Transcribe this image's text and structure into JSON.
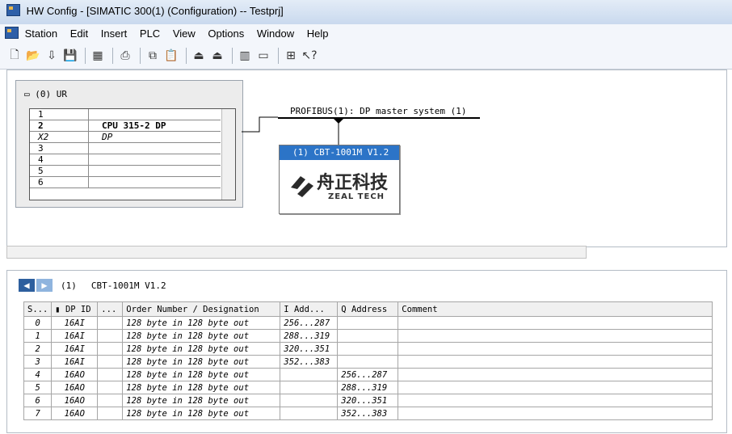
{
  "window": {
    "title": "HW Config - [SIMATIC 300(1) (Configuration) -- Testprj]"
  },
  "menu": [
    "Station",
    "Edit",
    "Insert",
    "PLC",
    "View",
    "Options",
    "Window",
    "Help"
  ],
  "toolbar": [
    "new-icon",
    "open-icon",
    "save-compile-icon",
    "save-icon",
    "download-icon",
    "print-icon",
    "copy-icon",
    "paste-icon",
    "rack-up-icon",
    "rack-down-icon",
    "catalog-icon",
    "properties-icon",
    "network-icon",
    "help-icon"
  ],
  "rack": {
    "title": "(0) UR",
    "rows": [
      {
        "slot": "1",
        "module": ""
      },
      {
        "slot": "2",
        "module": "CPU 315-2 DP"
      },
      {
        "slot": "X2",
        "module": "DP"
      },
      {
        "slot": "3",
        "module": ""
      },
      {
        "slot": "4",
        "module": ""
      },
      {
        "slot": "5",
        "module": ""
      },
      {
        "slot": "6",
        "module": ""
      }
    ]
  },
  "profibus": {
    "label": "PROFIBUS(1): DP master system (1)"
  },
  "device": {
    "title": "(1) CBT-1001M V1.2",
    "logo_cn": "舟正科技",
    "logo_en": "ZEAL TECH"
  },
  "detail": {
    "title_num": "(1)",
    "title": "CBT-1001M V1.2",
    "columns": [
      "S...",
      "DP ID",
      "...",
      "Order Number / Designation",
      "I Add...",
      "Q Address",
      "Comment"
    ],
    "rows": [
      {
        "s": "0",
        "id": "16AI",
        "order": "128 byte in 128 byte out",
        "i": "256...287",
        "q": ""
      },
      {
        "s": "1",
        "id": "16AI",
        "order": "128 byte in 128 byte out",
        "i": "288...319",
        "q": ""
      },
      {
        "s": "2",
        "id": "16AI",
        "order": "128 byte in 128 byte out",
        "i": "320...351",
        "q": ""
      },
      {
        "s": "3",
        "id": "16AI",
        "order": "128 byte in 128 byte out",
        "i": "352...383",
        "q": ""
      },
      {
        "s": "4",
        "id": "16AO",
        "order": "128 byte in 128 byte out",
        "i": "",
        "q": "256...287"
      },
      {
        "s": "5",
        "id": "16AO",
        "order": "128 byte in 128 byte out",
        "i": "",
        "q": "288...319"
      },
      {
        "s": "6",
        "id": "16AO",
        "order": "128 byte in 128 byte out",
        "i": "",
        "q": "320...351"
      },
      {
        "s": "7",
        "id": "16AO",
        "order": "128 byte in 128 byte out",
        "i": "",
        "q": "352...383"
      }
    ]
  }
}
